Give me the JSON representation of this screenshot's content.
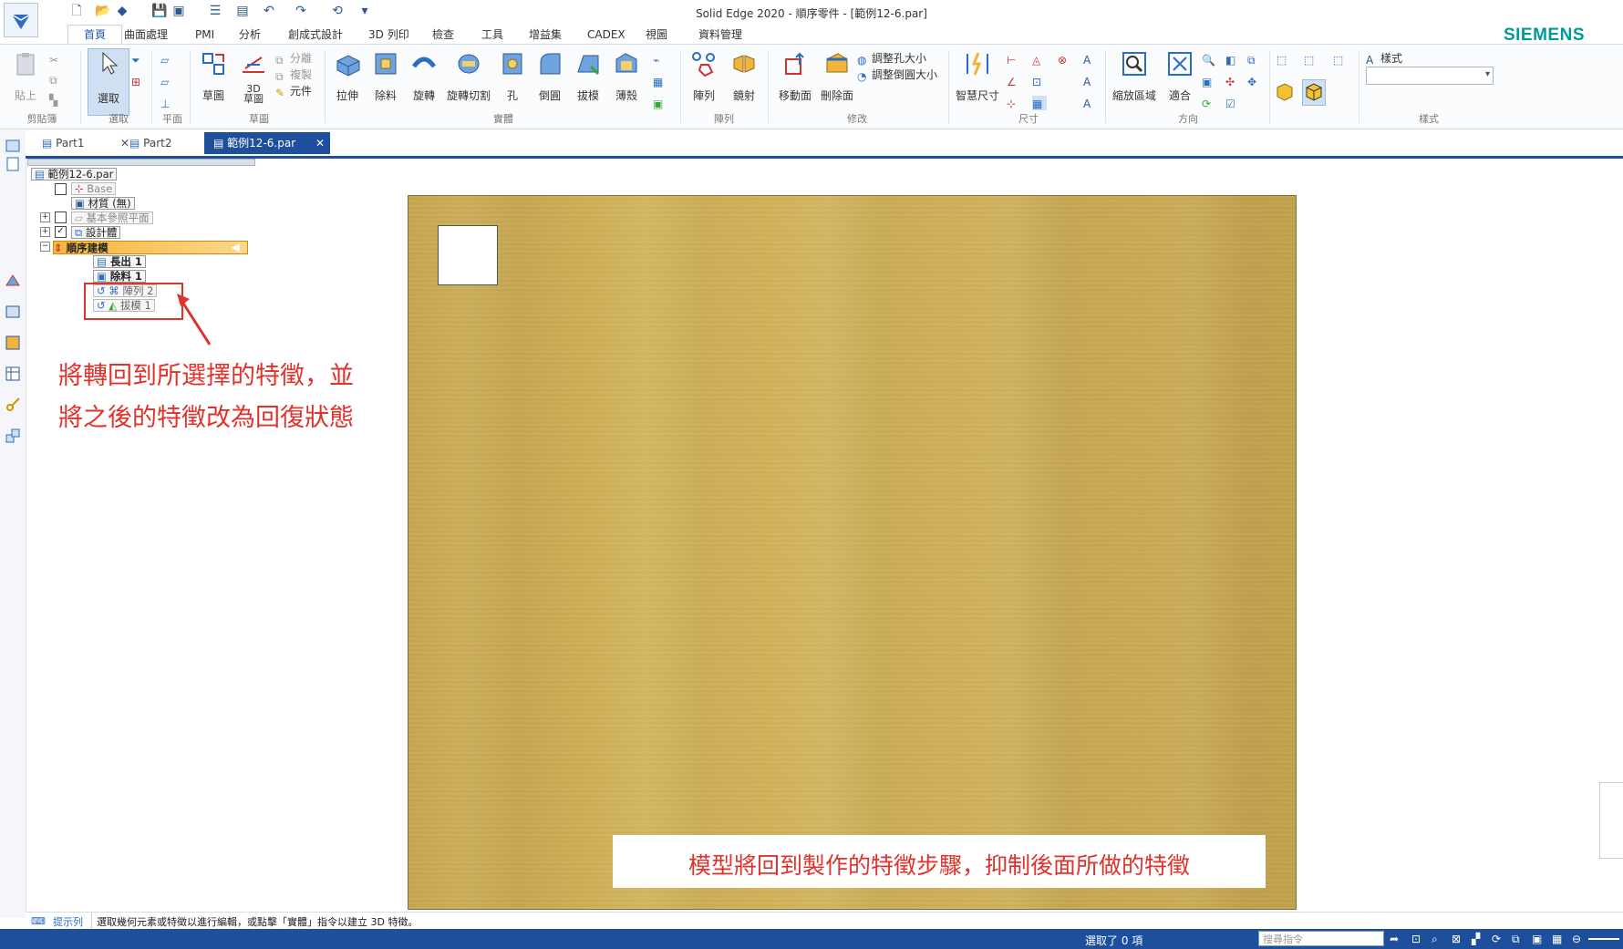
{
  "window": {
    "title": "Solid Edge 2020 - 順序零件 - [範例12-6.par]"
  },
  "brand": "SIEMENS",
  "ribbon_tabs": [
    "首頁",
    "曲面處理",
    "PMI",
    "分析",
    "創成式設計",
    "3D 列印",
    "檢查",
    "工具",
    "增益集",
    "CADEX",
    "視圖",
    "資料管理"
  ],
  "ribbon": {
    "clipboard": {
      "paste": "貼上",
      "group": "剪貼簿"
    },
    "select": {
      "select": "選取",
      "group": "選取"
    },
    "plane": {
      "group": "平面"
    },
    "sketch": {
      "sketch": "草圖",
      "sketch3d": "3D\n草圖",
      "split": "分離",
      "copy": "複製",
      "component": "元件",
      "group": "草圖"
    },
    "solids": {
      "extrude": "拉伸",
      "cutout": "除料",
      "revolve": "旋轉",
      "revolve_cut": "旋轉切割",
      "hole": "孔",
      "round": "倒圓",
      "draft": "拔模",
      "thin": "薄殼",
      "group": "實體"
    },
    "pattern": {
      "pattern": "陣列",
      "mirror": "鏡射",
      "group": "陣列"
    },
    "modify": {
      "move_face": "移動面",
      "delete_face": "刪除面",
      "resize_hole": "調整孔大小",
      "resize_round": "調整倒圓大小",
      "group": "修改"
    },
    "dimension": {
      "smart_dim": "智慧尺寸",
      "group": "尺寸"
    },
    "orient": {
      "zoom_area": "縮放區域",
      "fit": "適合",
      "group": "方向"
    },
    "style": {
      "style_label": "樣式",
      "group": "樣式",
      "style_value": ""
    }
  },
  "doc_tabs": [
    {
      "label": "Part1",
      "active": false
    },
    {
      "label": "Part2",
      "active": false
    },
    {
      "label": "範例12-6.par",
      "active": true
    }
  ],
  "tree": {
    "root": "範例12-6.par",
    "base": "Base",
    "material": "材質 (無)",
    "base_planes": "基本參照平面",
    "design_body": "設計體",
    "ordered": "順序建模",
    "features": [
      "長出 1",
      "除料 1",
      "陣列 2",
      "拔模 1"
    ]
  },
  "annotations": {
    "left_line1": "將轉回到所選擇的特徵，並",
    "left_line2": "將之後的特徵改為回復狀態",
    "right": "模型將回到製作的特徵步驟，抑制後面所做的特徵",
    "color": "#e0322c"
  },
  "prompt": {
    "label": "提示列",
    "text": "選取幾何元素或特徵以進行編輯，或點擊「實體」指令以建立 3D 特徵。"
  },
  "status": {
    "selected": "選取了 0 項",
    "search_placeholder": "搜尋指令"
  },
  "colors": {
    "accent": "#1e4f9c",
    "brand": "#009999",
    "model": "#cfb158"
  }
}
